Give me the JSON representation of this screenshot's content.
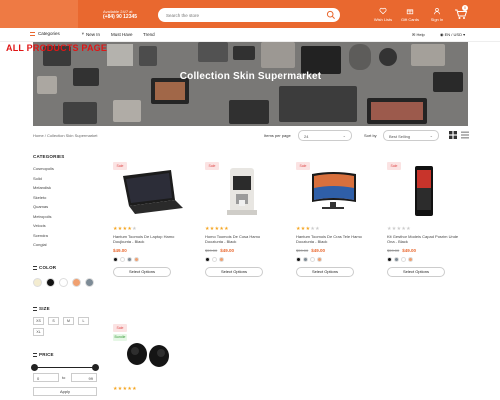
{
  "header": {
    "hotline_label": "Available 24/7 at",
    "hotline_number": "(+84) 90 12345",
    "search_placeholder": "Search the store",
    "links": [
      {
        "label": "Wish Lists",
        "icon": "heart-icon"
      },
      {
        "label": "Gift Cards",
        "icon": "gift-icon"
      },
      {
        "label": "Sign In",
        "icon": "user-icon"
      }
    ],
    "cart_count": "0",
    "brand_color": "#e9682f"
  },
  "nav": {
    "categories_label": "Categories",
    "items": [
      "New In",
      "Must Have",
      "Trend"
    ],
    "help_label": "Help",
    "locale_label": "EN / USD"
  },
  "hero": {
    "title": "Collection Skin Supermarket",
    "overlay_caption": "ALL PRODUCTS PAGE"
  },
  "breadcrumb": {
    "text": "Home / Collection Skin Supermarket"
  },
  "toolbar": {
    "items_per_page_label": "Items per page",
    "items_per_page_value": "24",
    "sort_label": "Sort by",
    "sort_value": "Best Selling"
  },
  "sidebar": {
    "categories_title": "CATEGORIES",
    "categories": [
      "Cosmopolis",
      "Solid",
      "Melandisk",
      "Skeleto",
      "Quamas",
      "Metropolis",
      "Velocis",
      "Scendra",
      "Congial"
    ],
    "color_title": "COLOR",
    "colors": [
      "#f3ecd0",
      "#111111",
      "#ffffff",
      "#f0a070",
      "#7d8b96"
    ],
    "size_title": "SIZE",
    "sizes": [
      "XS",
      "S",
      "M",
      "L",
      "XL"
    ],
    "price_title": "PRICE",
    "price_min": "0",
    "price_max": "99",
    "price_to_label": "to",
    "apply_label": "Apply"
  },
  "products": [
    {
      "name": "Hantum Toomois De Laptop Hamo Doujkunta - Black",
      "sale": "Sale",
      "old_price": "",
      "price": "$49.00",
      "stars": 4,
      "colors": [
        "#111111",
        "#ffffff",
        "#7d8b96",
        "#f0a070"
      ],
      "button": "Select Options",
      "icon": "laptop-image"
    },
    {
      "name": "Homo Toomois De Cosa Hamo Dooziunta - Black",
      "sale": "Sale",
      "old_price": "$59.00",
      "price": "$49.00",
      "stars": 5,
      "colors": [
        "#111111",
        "#ffffff",
        "#f0a070"
      ],
      "button": "Select Options",
      "icon": "coffee-machine-image"
    },
    {
      "name": "Hantum Toomois De Cras Tele Hamo Dooziunta - Black",
      "sale": "Sale",
      "old_price": "$59.00",
      "price": "$49.00",
      "stars": 3,
      "colors": [
        "#111111",
        "#7d8b96",
        "#ffffff",
        "#f0a070"
      ],
      "button": "Select Options",
      "icon": "tv-image"
    },
    {
      "name": "Kit Gesthor Modeis Capad Posrim Unde Ona - Black",
      "sale": "Sale",
      "old_price": "$59.00",
      "price": "$49.00",
      "stars": 0,
      "colors": [
        "#111111",
        "#7d8b96",
        "#ffffff",
        "#f0a070"
      ],
      "button": "Select Options",
      "icon": "phone-image"
    },
    {
      "name": "",
      "sale": "Sale",
      "new": "Bundle",
      "old_price": "",
      "price": "",
      "stars": 5,
      "colors": [],
      "button": "",
      "icon": "earbuds-image"
    }
  ]
}
